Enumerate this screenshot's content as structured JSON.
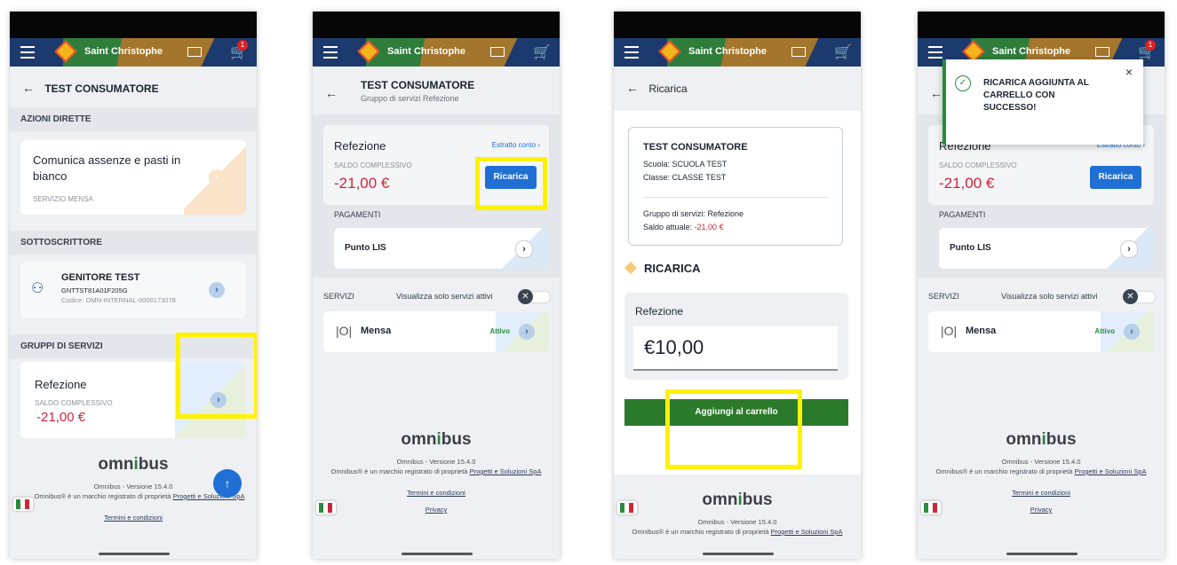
{
  "app": {
    "title": "Saint Christophe",
    "cart_badge": "1"
  },
  "screen1": {
    "header": "TEST CONSUMATORE",
    "section_actions": "AZIONI DIRETTE",
    "action_title": "Comunica assenze e pasti in bianco",
    "action_sub": "SERVIZIO MENSA",
    "section_subscriber": "SOTTOSCRITTORE",
    "subscriber_name": "GENITORE TEST",
    "subscriber_code1": "GNTTST81A01F205G",
    "subscriber_code2": "Codice: OMN-INTERNAL-0000173078",
    "section_groups": "GRUPPI DI SERVIZI",
    "group_name": "Refezione",
    "group_balance_label": "SALDO COMPLESSIVO",
    "group_balance": "-21,00 €"
  },
  "screen2": {
    "header": "TEST CONSUMATORE",
    "subheader": "Gruppo di servizi Refezione",
    "card_title": "Refezione",
    "statement_link": "Estratto conto ›",
    "balance_label": "SALDO COMPLESSIVO",
    "balance": "-21,00 €",
    "recharge_button": "Ricarica",
    "payments_label": "PAGAMENTI",
    "payment_point": "Punto LIS",
    "services_label": "SERVIZI",
    "active_toggle_label": "Visualizza solo servizi attivi",
    "service_name": "Mensa",
    "service_status": "Attivo"
  },
  "screen3": {
    "header": "Ricarica",
    "consumer": "TEST CONSUMATORE",
    "school": "Scuola:  SCUOLA TEST",
    "class": "Classe:  CLASSE TEST",
    "group": "Gruppo di servizi:  Refezione",
    "balance_label": "Saldo attuale: ",
    "balance": "-21,00 €",
    "recharge_title": "RICARICA",
    "amount_label": "Refezione",
    "amount": "€10,00",
    "add_to_cart": "Aggiungi al carrello"
  },
  "screen4": {
    "toast": "RICARICA AGGIUNTA AL CARRELLO CON SUCCESSO!",
    "card_title": "Refezione",
    "statement_link": "Estratto conto ›",
    "balance_label": "SALDO COMPLESSIVO",
    "balance": "-21,00 €",
    "recharge_button": "Ricarica",
    "payments_label": "PAGAMENTI",
    "payment_point": "Punto LIS",
    "services_label": "SERVIZI",
    "active_toggle_label": "Visualizza solo servizi attivi",
    "service_name": "Mensa",
    "service_status": "Attivo"
  },
  "footer": {
    "brand_a": "omn",
    "brand_b": "i",
    "brand_c": "bus",
    "version": "Omnibus - Versione 15.4.0",
    "trademark": "Omnibus® è un marchio registrato di proprietà",
    "company": "Progetti e Soluzioni SpA",
    "terms": "Termini e condizioni",
    "privacy": "Privacy"
  },
  "colors": {
    "brand_blue": "#1d3a6e",
    "accent_blue": "#1f6fd4",
    "negative_red": "#d0263a",
    "cart_green": "#2b7a2b",
    "highlight_yellow": "#fff200"
  }
}
